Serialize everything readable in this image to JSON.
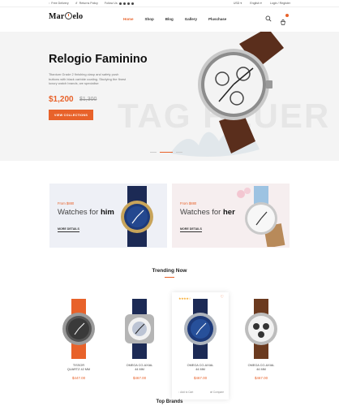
{
  "topbar": {
    "free_delivery": "Free Delivery",
    "returns": "Returns Policy",
    "follow": "Follow Us",
    "currency": "USD",
    "language": "English",
    "account": "Login / Register"
  },
  "header": {
    "logo_a": "Mar",
    "logo_b": "elo",
    "nav": [
      "Home",
      "Shop",
      "Blog",
      "Gallery",
      "Pluschase"
    ]
  },
  "hero": {
    "title": "Relogio Faminino",
    "description": "Titanium Grade 2 finishing clasp and safety push buttons with black carbide coating. Studying the finest luxury watch brands, we specialise",
    "price": "$1,200",
    "old_price": "$1,300",
    "button": "VIEW COLLECTIONS",
    "bg_text": "TAG HEUER"
  },
  "banners": [
    {
      "from": "From $880",
      "title_a": "Watches for ",
      "title_b": "him",
      "more": "MORE DETAILS"
    },
    {
      "from": "From $880",
      "title_a": "Watches for ",
      "title_b": "her",
      "more": "MORE DETAILS"
    }
  ],
  "trending": {
    "title": "Trending Now",
    "products": [
      {
        "name_l1": "TISSOR",
        "name_l2": "QUARTZ 42 MM",
        "price": "$447.00",
        "strap": "#e8622a",
        "face": "#555555"
      },
      {
        "name_l1": "OMEGA CO-AXIAL",
        "name_l2": "44 MM",
        "price": "$467.00",
        "strap": "#1c2a55",
        "face": "#f2f2f2"
      },
      {
        "name_l1": "OMEGA CO-AXIAL",
        "name_l2": "44 MM",
        "price": "$467.00",
        "strap": "#1c2a55",
        "face": "#1d3a7a",
        "stars": "★★★★☆",
        "heart": "♡",
        "add": "Add to Cart",
        "compare": "Compare"
      },
      {
        "name_l1": "OMEGA CO-AXIAL",
        "name_l2": "44 MM",
        "price": "$467.00",
        "strap": "#6b3a1f",
        "face": "#f2f2f2"
      }
    ]
  },
  "brands": {
    "title": "Top Brands"
  },
  "colors": {
    "accent": "#e8622a"
  }
}
